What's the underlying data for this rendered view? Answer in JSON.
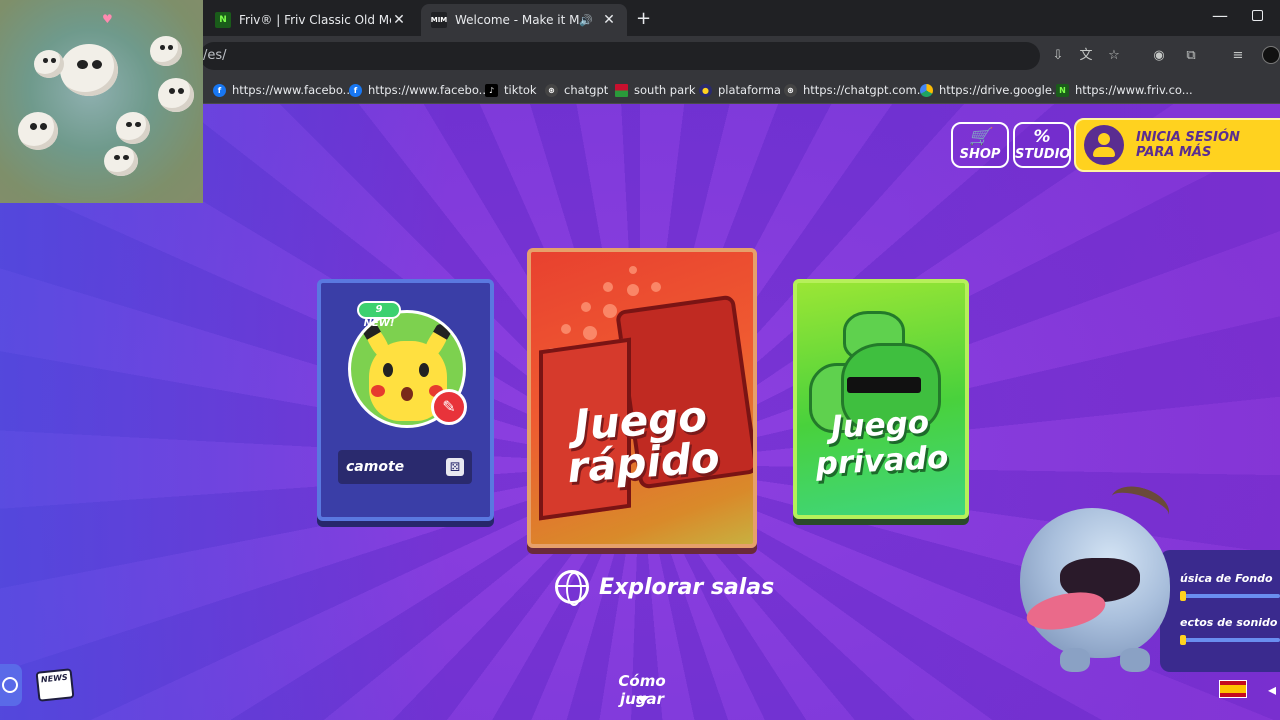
{
  "browser": {
    "tabs": [
      {
        "title": "Friv® | Friv Classic Old Menu",
        "favicon_text": "N",
        "favicon_color": "#1a5c1a",
        "active": false
      },
      {
        "title": "Welcome - Make it Meme",
        "favicon_text": "MIM",
        "favicon_color": "#ffffff",
        "active": true
      }
    ],
    "url": "/es/",
    "bookmarks": [
      {
        "label": "https://www.facebo...",
        "icon": "facebook-icon",
        "color": "#1877f2",
        "glyph": "f"
      },
      {
        "label": "https://www.facebo...",
        "icon": "facebook-icon",
        "color": "#1877f2",
        "glyph": "f"
      },
      {
        "label": "tiktok",
        "icon": "tiktok-icon",
        "color": "#000000",
        "glyph": "♪"
      },
      {
        "label": "chatgpt",
        "icon": "chatgpt-icon",
        "color": "#444444",
        "glyph": "⊛"
      },
      {
        "label": "south park",
        "icon": "south-park-icon",
        "color": "#c8102e",
        "glyph": "■"
      },
      {
        "label": "plataforma",
        "icon": "plataforma-icon",
        "color": "#2a2a6e",
        "glyph": "●"
      },
      {
        "label": "https://chatgpt.com...",
        "icon": "chatgpt-icon",
        "color": "#444444",
        "glyph": "⊛"
      },
      {
        "label": "https://drive.google...",
        "icon": "google-drive-icon",
        "color": "#1fa463",
        "glyph": "▲"
      },
      {
        "label": "https://www.friv.co...",
        "icon": "friv-icon",
        "color": "#1a5c1a",
        "glyph": "N"
      }
    ]
  },
  "header": {
    "shop_label": "SHOP",
    "studio_label": "STUDIO",
    "login_label": "INICIA SESIÓN\nPARA MÁS"
  },
  "profile": {
    "new_badge": "9 NEW!",
    "name": "camote"
  },
  "modes": {
    "quick_line1": "Juego",
    "quick_line2": "rápido",
    "private_line1": "Juego",
    "private_line2": "privado"
  },
  "explore_label": "Explorar salas",
  "how_to_play": "Cómo jugar",
  "news_label": "NEWS",
  "audio": {
    "music_label": "úsica de Fondo",
    "effects_label": "ectos de sonido"
  },
  "colors": {
    "accent_yellow": "#ffd21f",
    "bg_purple": "#8d3fe0"
  }
}
